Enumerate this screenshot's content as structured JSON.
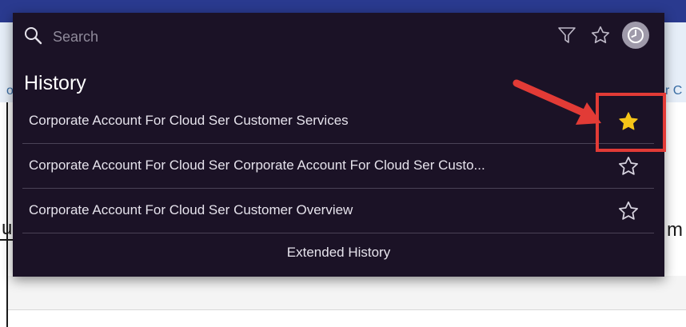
{
  "background": {
    "left_fragment": "o",
    "right_fragment": "r C",
    "left_big_fragment": "u",
    "right_big_fragment": "m"
  },
  "search": {
    "placeholder": "Search",
    "icon": "search-icon"
  },
  "toolbar": {
    "filter_icon": "funnel-icon",
    "favorites_icon": "star-outline-icon",
    "history_icon": "clock-icon"
  },
  "history": {
    "title": "History",
    "items": [
      {
        "label": "Corporate Account For Cloud Ser Customer Services",
        "favorite": true
      },
      {
        "label": "Corporate Account For Cloud Ser Corporate Account For Cloud Ser Custo...",
        "favorite": false
      },
      {
        "label": "Corporate Account For Cloud Ser Customer Overview",
        "favorite": false
      }
    ],
    "extended_label": "Extended History"
  },
  "colors": {
    "panel_bg": "#1b1226",
    "favorite_star": "#f5c518",
    "annotation": "#e23b36"
  }
}
